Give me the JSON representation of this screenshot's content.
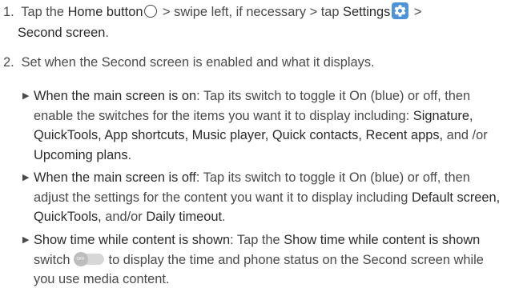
{
  "step1": {
    "number": "1.",
    "t1": "Tap the ",
    "home_label": "Home button",
    "t2": " > swipe left, if necessary > tap ",
    "settings_label": "Settings",
    "t3": " >",
    "second_screen": "Second screen",
    "period": "."
  },
  "step2": {
    "number": "2.",
    "text": "Set when the Second screen is enabled and what it displays."
  },
  "bullet1": {
    "heading": "When the main screen is on",
    "t1": ": Tap its switch to toggle it On (blue) or off, then enable the switches for the items you want it to display including: ",
    "items": "Signature, QuickTools, App shortcuts, Music player, Quick contacts, Recent apps,",
    "t2": " and /or ",
    "last": "Upcoming plans",
    "period": "."
  },
  "bullet2": {
    "heading": "When the main screen is off",
    "t1": ": Tap its switch to toggle it On (blue) or off, then adjust the settings for the content you want it to display including ",
    "items": "Default screen, QuickTools,",
    "t2": " and/or ",
    "last": "Daily timeout",
    "period": "."
  },
  "bullet3": {
    "heading": "Show time while content is shown",
    "t1": ": Tap the ",
    "switch_name": "Show time while content is shown",
    "t2": " switch",
    "switch_knob": "OFF",
    "t3": "to display the time and phone status on the Second screen while you use media content."
  }
}
